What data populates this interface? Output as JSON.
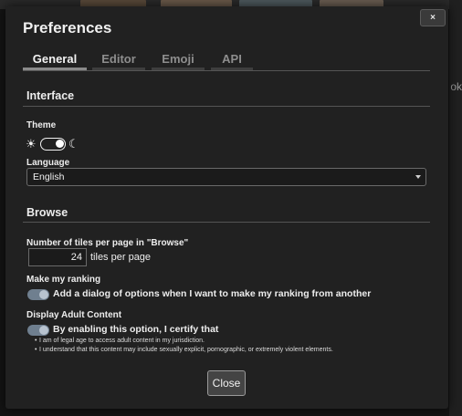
{
  "title": "Preferences",
  "close_x": "×",
  "tabs": [
    {
      "label": "General",
      "active": true
    },
    {
      "label": "Editor",
      "active": false
    },
    {
      "label": "Emoji",
      "active": false
    },
    {
      "label": "API",
      "active": false
    }
  ],
  "interface": {
    "heading": "Interface",
    "theme_label": "Theme",
    "theme_icons": {
      "light": "☀",
      "dark": "☾"
    },
    "language_label": "Language",
    "language_value": "English"
  },
  "browse": {
    "heading": "Browse",
    "tiles_label": "Number of tiles per page in \"Browse\"",
    "tiles_value": "24",
    "tiles_suffix": "tiles per page",
    "ranking_label": "Make my ranking",
    "ranking_toggle_label": "Add a dialog of options when I want to make my ranking from another",
    "adult_label": "Display Adult Content",
    "adult_toggle_label": "By enabling this option, I certify that",
    "adult_bullets": [
      "I am of legal age to access adult content in my jurisdiction.",
      "I understand that this content may include sexually explicit, pornographic, or extremely violent elements."
    ]
  },
  "footer": {
    "close_label": "Close"
  },
  "background": {
    "side_text": "ok"
  }
}
